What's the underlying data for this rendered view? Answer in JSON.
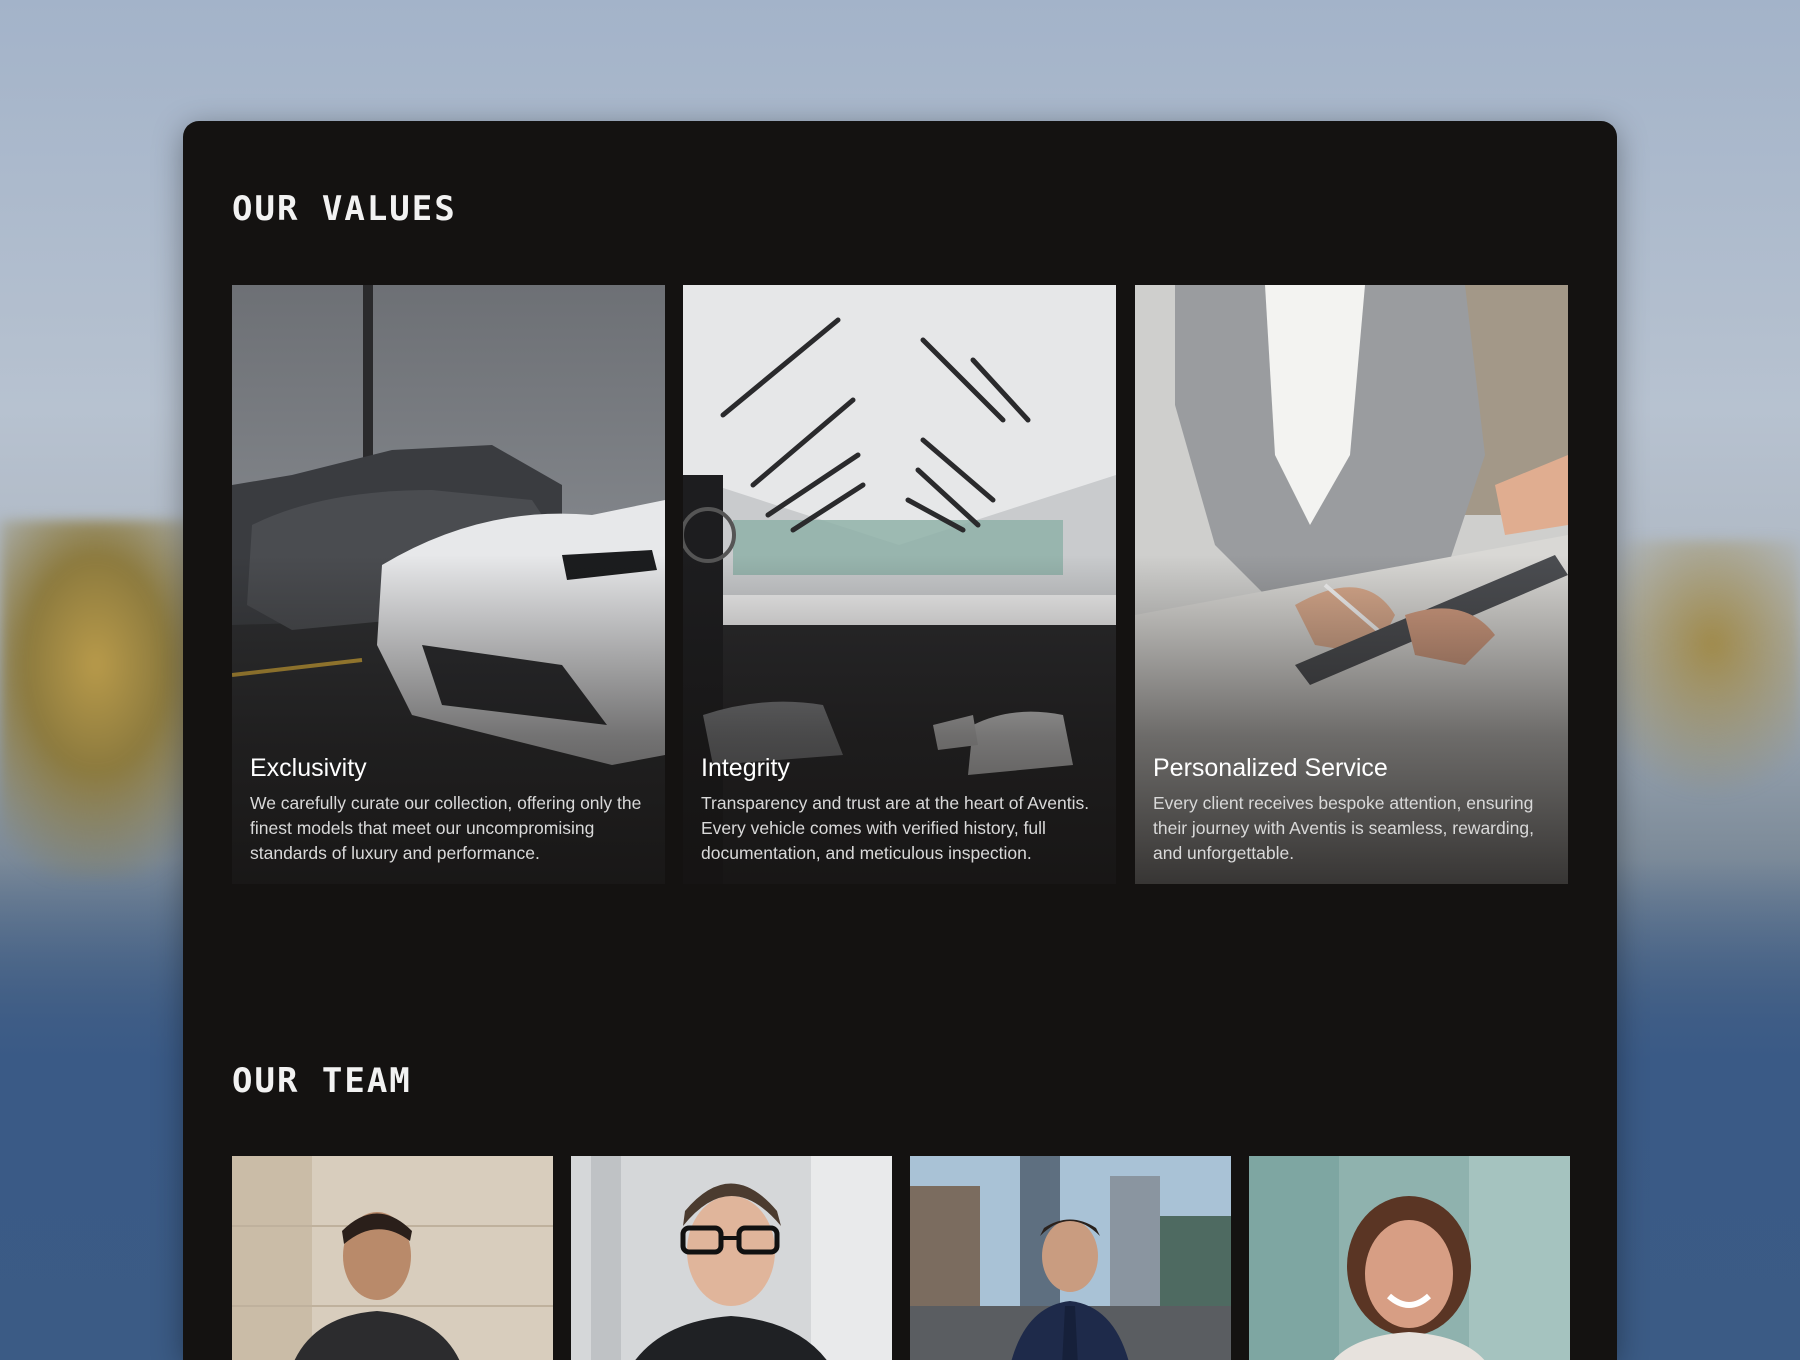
{
  "values": {
    "heading": "OUR VALUES",
    "cards": [
      {
        "title": "Exclusivity",
        "description": "We carefully curate our collection, offering only the finest models that meet our uncompromising standards of luxury and performance."
      },
      {
        "title": "Integrity",
        "description": "Transparency and trust are at the heart of Aventis. Every vehicle comes with verified history, full documentation, and meticulous inspection."
      },
      {
        "title": "Personalized Service",
        "description": "Every client receives bespoke attention, ensuring their journey with Aventis is seamless, rewarding, and unforgettable."
      }
    ]
  },
  "team": {
    "heading": "OUR TEAM"
  }
}
